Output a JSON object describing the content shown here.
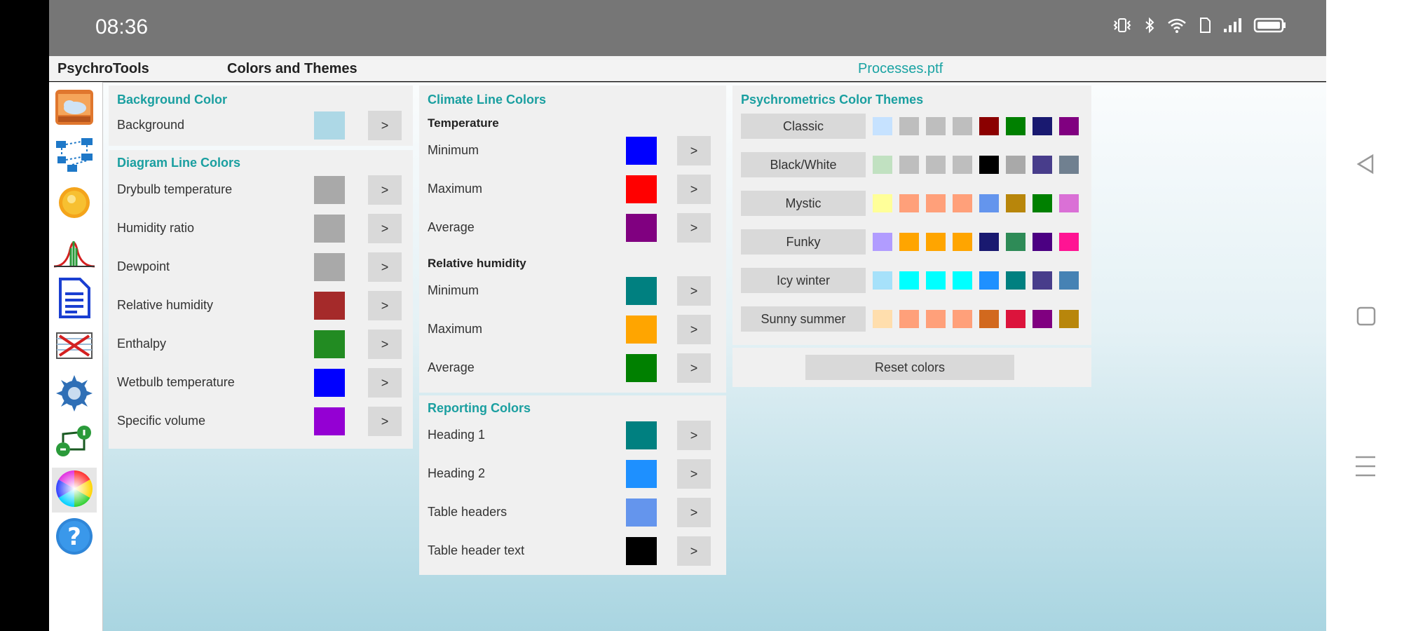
{
  "status_bar": {
    "time": "08:36",
    "icons": [
      "vibrate-icon",
      "bluetooth-icon",
      "wifi-icon",
      "sim-icon",
      "signal-icon",
      "battery-icon"
    ]
  },
  "titlebar": {
    "app_name": "PsychroTools",
    "page_name": "Colors and Themes",
    "file_name": "Processes.ptf"
  },
  "sidebar": [
    {
      "name": "weather-icon"
    },
    {
      "name": "process-flow-icon"
    },
    {
      "name": "sun-icon"
    },
    {
      "name": "distribution-chart-icon"
    },
    {
      "name": "document-icon"
    },
    {
      "name": "chart-clear-icon"
    },
    {
      "name": "settings-gear-icon"
    },
    {
      "name": "process-link-icon"
    },
    {
      "name": "color-wheel-icon",
      "active": true
    },
    {
      "name": "help-icon"
    }
  ],
  "background_panel": {
    "title": "Background Color",
    "rows": [
      {
        "label": "Background",
        "color": "#ADD8E6",
        "button": ">"
      }
    ]
  },
  "diagram_panel": {
    "title": "Diagram Line Colors",
    "rows": [
      {
        "label": "Drybulb temperature",
        "color": "#A9A9A9",
        "button": ">"
      },
      {
        "label": "Humidity ratio",
        "color": "#A9A9A9",
        "button": ">"
      },
      {
        "label": "Dewpoint",
        "color": "#A9A9A9",
        "button": ">"
      },
      {
        "label": "Relative humidity",
        "color": "#A52A2A",
        "button": ">"
      },
      {
        "label": "Enthalpy",
        "color": "#228B22",
        "button": ">"
      },
      {
        "label": "Wetbulb temperature",
        "color": "#0000FF",
        "button": ">"
      },
      {
        "label": "Specific volume",
        "color": "#9400D3",
        "button": ">"
      }
    ]
  },
  "climate_panel": {
    "title": "Climate Line Colors",
    "groups": [
      {
        "heading": "Temperature",
        "rows": [
          {
            "label": "Minimum",
            "color": "#0000FF",
            "button": ">"
          },
          {
            "label": "Maximum",
            "color": "#FF0000",
            "button": ">"
          },
          {
            "label": "Average",
            "color": "#800080",
            "button": ">"
          }
        ]
      },
      {
        "heading": "Relative humidity",
        "rows": [
          {
            "label": "Minimum",
            "color": "#008080",
            "button": ">"
          },
          {
            "label": "Maximum",
            "color": "#FFA500",
            "button": ">"
          },
          {
            "label": "Average",
            "color": "#008000",
            "button": ">"
          }
        ]
      }
    ]
  },
  "reporting_panel": {
    "title": "Reporting Colors",
    "rows": [
      {
        "label": "Heading 1",
        "color": "#008080",
        "button": ">"
      },
      {
        "label": "Heading 2",
        "color": "#1E90FF",
        "button": ">"
      },
      {
        "label": "Table headers",
        "color": "#6495ED",
        "button": ">"
      },
      {
        "label": "Table header text",
        "color": "#000000",
        "button": ">"
      }
    ]
  },
  "themes_panel": {
    "title": "Psychrometrics Color Themes",
    "themes": [
      {
        "name": "Classic",
        "colors": [
          "#C6E2FF",
          "#BEBEBE",
          "#BEBEBE",
          "#BEBEBE",
          "#8B0000",
          "#008000",
          "#191970",
          "#800080"
        ]
      },
      {
        "name": "Black/White",
        "colors": [
          "#C1E1C1",
          "#BEBEBE",
          "#BEBEBE",
          "#BEBEBE",
          "#000000",
          "#A9A9A9",
          "#483D8B",
          "#708090"
        ]
      },
      {
        "name": "Mystic",
        "colors": [
          "#FFFF99",
          "#FFA07A",
          "#FFA07A",
          "#FFA07A",
          "#6495ED",
          "#B8860B",
          "#008000",
          "#DA70D6"
        ]
      },
      {
        "name": "Funky",
        "colors": [
          "#B19CFF",
          "#FFA500",
          "#FFA500",
          "#FFA500",
          "#191970",
          "#2E8B57",
          "#4B0082",
          "#FF1493"
        ]
      },
      {
        "name": "Icy winter",
        "colors": [
          "#A6E1FA",
          "#00FFFF",
          "#00FFFF",
          "#00FFFF",
          "#1E90FF",
          "#008080",
          "#483D8B",
          "#4682B4"
        ]
      },
      {
        "name": "Sunny summer",
        "colors": [
          "#FFDEAD",
          "#FFA07A",
          "#FFA07A",
          "#FFA07A",
          "#D2691E",
          "#DC143C",
          "#800080",
          "#B8860B"
        ]
      }
    ],
    "reset_label": "Reset colors"
  },
  "nav": {
    "icons": [
      "back-triangle-icon",
      "home-square-icon",
      "recents-menu-icon"
    ]
  }
}
